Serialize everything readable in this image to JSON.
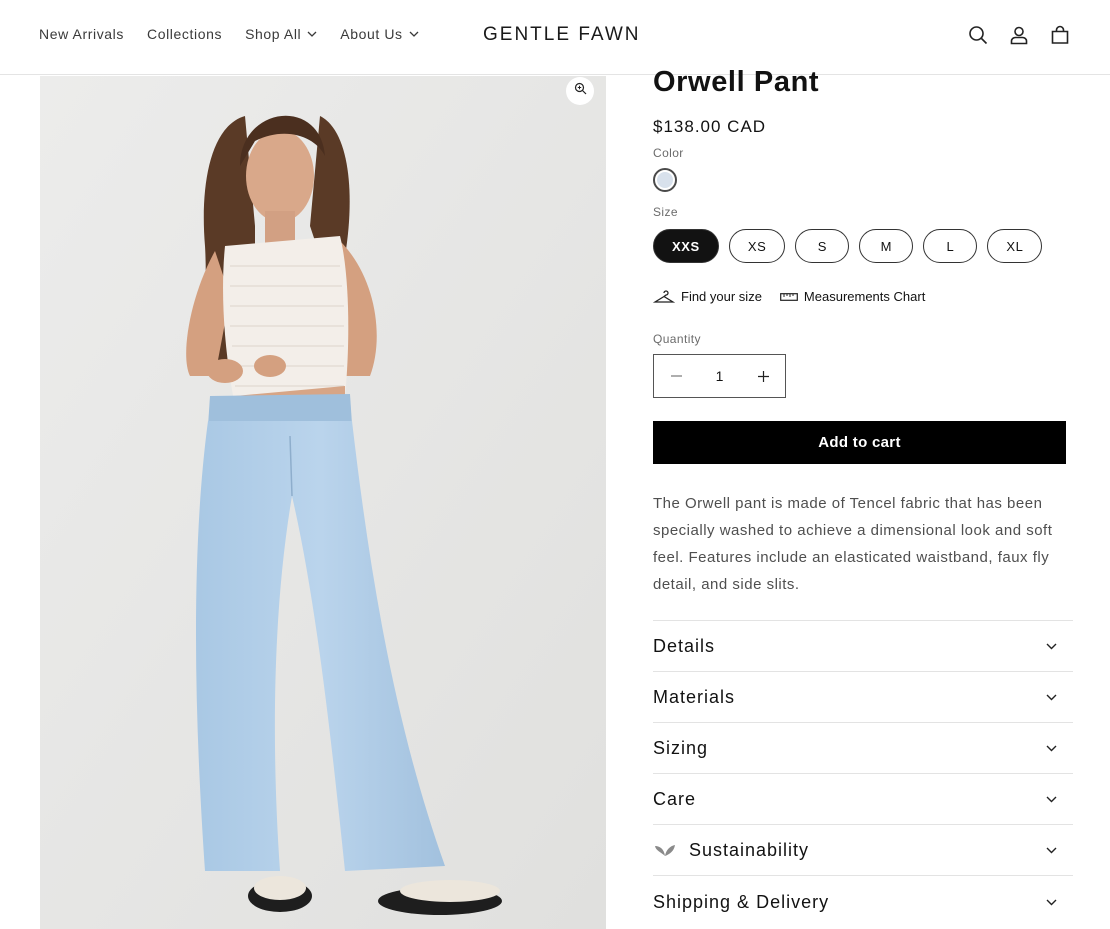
{
  "header": {
    "nav": [
      {
        "label": "New Arrivals",
        "dropdown": false
      },
      {
        "label": "Collections",
        "dropdown": false
      },
      {
        "label": "Shop All",
        "dropdown": true
      },
      {
        "label": "About Us",
        "dropdown": true
      }
    ],
    "logo": {
      "part1": "GENTLE",
      "part2": "FAWN"
    },
    "icons": [
      "search-icon",
      "account-icon",
      "cart-icon"
    ]
  },
  "media": {
    "zoom_icon": "zoom-icon"
  },
  "product": {
    "title": "Orwell Pant",
    "price": "$138.00 CAD",
    "color_label": "Color",
    "color_swatch": "#d8e1ec",
    "size_label": "Size",
    "sizes": [
      "XXS",
      "XS",
      "S",
      "M",
      "L",
      "XL"
    ],
    "selected_size": "XXS",
    "find_size": "Find your size",
    "measurements": "Measurements Chart",
    "quantity_label": "Quantity",
    "quantity": "1",
    "add_to_cart": "Add to cart",
    "description": "The Orwell pant is made of Tencel fabric that has been specially washed to achieve a dimensional look and soft feel. Features include an elasticated waistband, faux fly detail, and side slits."
  },
  "accordion": [
    {
      "label": "Details",
      "icon": ""
    },
    {
      "label": "Materials",
      "icon": ""
    },
    {
      "label": "Sizing",
      "icon": ""
    },
    {
      "label": "Care",
      "icon": ""
    },
    {
      "label": "Sustainability",
      "icon": "leaf-icon"
    },
    {
      "label": "Shipping & Delivery",
      "icon": ""
    }
  ]
}
